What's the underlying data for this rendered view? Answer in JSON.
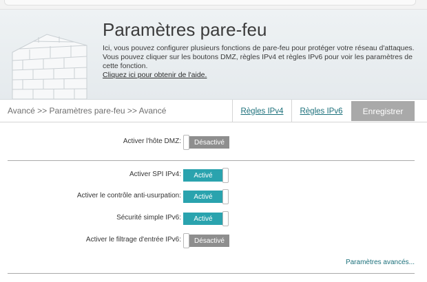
{
  "header": {
    "title": "Paramètres pare-feu",
    "description": "Ici, vous pouvez configurer plusieurs fonctions de pare-feu pour protéger votre réseau d'attaques. Vous pouvez cliquer sur les boutons DMZ, règles IPv4 et règles IPv6 pour voir les paramètres de cette fonction.",
    "help_link": "Cliquez ici pour obtenir de l'aide."
  },
  "nav": {
    "breadcrumb": "Avancé >> Paramètres pare-feu >> Avancé",
    "ipv4_rules": "Règles IPv4",
    "ipv6_rules": "Règles IPv6",
    "save": "Enregistrer"
  },
  "settings": {
    "dmz": {
      "label": "Activer l'hôte DMZ:",
      "state": "Désactivé"
    },
    "spi_ipv4": {
      "label": "Activer SPI IPv4:",
      "state": "Activé"
    },
    "anti_spoof": {
      "label": "Activer le contrôle anti-usurpation:",
      "state": "Activé"
    },
    "ipv6_simple_security": {
      "label": "Sécurité simple IPv6:",
      "state": "Activé"
    },
    "ipv6_ingress": {
      "label": "Activer le filtrage d'entrée IPv6:",
      "state": "Désactivé"
    }
  },
  "advanced_link": "Paramètres avancés...",
  "colors": {
    "accent": "#2aa3ae",
    "toggle_off": "#8e8e8e",
    "link": "#1a6f7a",
    "save_button": "#a9a9a9"
  },
  "icons": {
    "header_illustration": "brick-wall-icon"
  }
}
